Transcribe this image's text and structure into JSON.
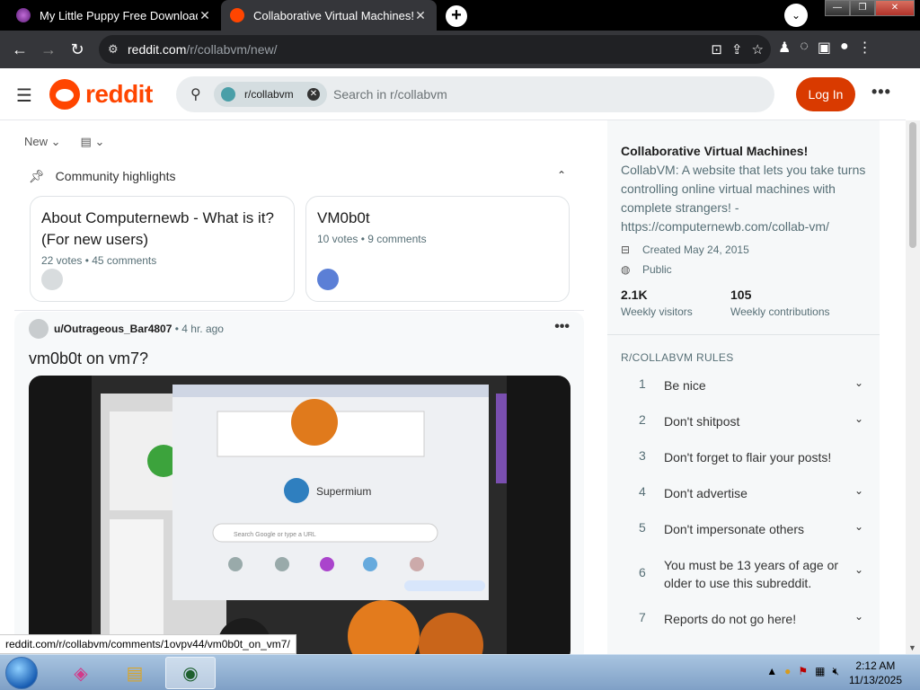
{
  "browser": {
    "tabs": [
      {
        "title": "My Little Puppy Free Download",
        "active": false
      },
      {
        "title": "Collaborative Virtual Machines!",
        "active": true
      }
    ],
    "new_tab": "+",
    "url_host": "reddit.com",
    "url_path": "/r/collabvm/new/",
    "status_url": "reddit.com/r/collabvm/comments/1ovpv44/vm0b0t_on_vm7/"
  },
  "header": {
    "logo_text": "reddit",
    "search_chip": "r/collabvm",
    "search_placeholder": "Search in r/collabvm",
    "login_label": "Log In"
  },
  "feed": {
    "sort_label": "New",
    "highlights_title": "Community highlights",
    "highlight_cards": [
      {
        "title": "About Computernewb - What is it? (For new users)",
        "meta": "22 votes • 45 comments"
      },
      {
        "title": "VM0b0t",
        "meta": "10 votes • 9 comments"
      }
    ],
    "post": {
      "username": "u/Outrageous_Bar4807",
      "age": "• 4 hr. ago",
      "title": "vm0b0t on vm7?",
      "screenshot_caption": "Supermium",
      "screenshot_search": "Search Google or type a URL"
    }
  },
  "sidebar": {
    "title": "Collaborative Virtual Machines!",
    "description": "CollabVM: A website that lets you take turns controlling online virtual machines with complete strangers! - https://computernewb.com/collab-vm/",
    "created": "Created May 24, 2015",
    "visibility": "Public",
    "stats": [
      {
        "value": "2.1K",
        "label": "Weekly visitors"
      },
      {
        "value": "105",
        "label": "Weekly contributions"
      }
    ],
    "rules_heading": "R/COLLABVM RULES",
    "rules": [
      {
        "n": "1",
        "text": "Be nice",
        "expandable": true
      },
      {
        "n": "2",
        "text": "Don't shitpost",
        "expandable": true
      },
      {
        "n": "3",
        "text": "Don't forget to flair your posts!",
        "expandable": false
      },
      {
        "n": "4",
        "text": "Don't advertise",
        "expandable": true
      },
      {
        "n": "5",
        "text": "Don't impersonate others",
        "expandable": true
      },
      {
        "n": "6",
        "text": "You must be 13 years of age or older to use this subreddit.",
        "expandable": true
      },
      {
        "n": "7",
        "text": "Reports do not go here!",
        "expandable": true
      }
    ]
  },
  "taskbar": {
    "time": "2:12 AM",
    "date": "11/13/2025"
  },
  "colors": {
    "reddit_orange": "#ff4500",
    "login_button": "#d93a00",
    "chrome_dark": "#35363a"
  }
}
